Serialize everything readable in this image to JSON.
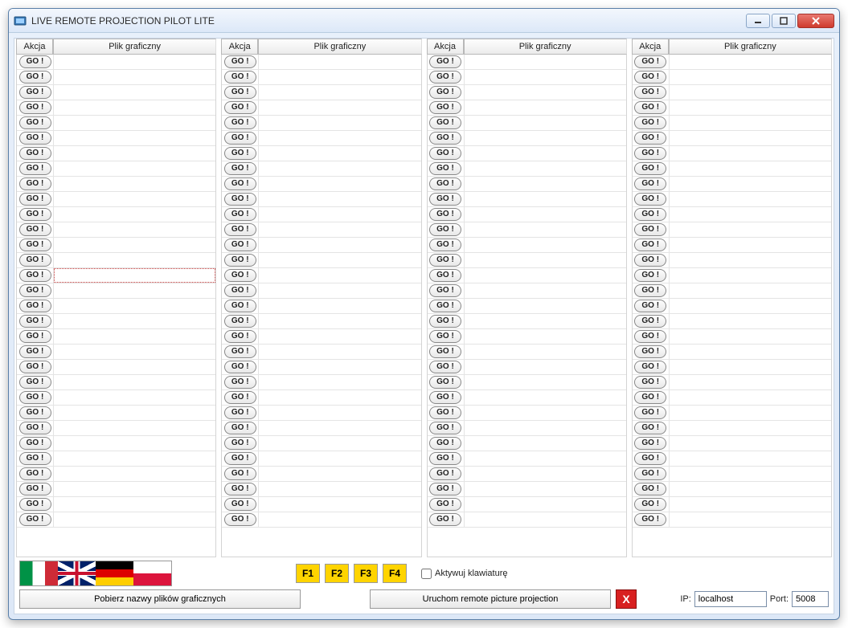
{
  "window": {
    "title": "LIVE REMOTE PROJECTION PILOT LITE"
  },
  "grid": {
    "header_action": "Akcja",
    "header_file": "Plik graficzny",
    "go_label": "GO !",
    "columns": 4,
    "rows_per_column": 31,
    "highlighted": {
      "col": 0,
      "row": 14
    }
  },
  "flags": [
    {
      "name": "italian",
      "css": "flag-it"
    },
    {
      "name": "english",
      "css": "flag-uk"
    },
    {
      "name": "german",
      "css": "flag-de"
    },
    {
      "name": "polish",
      "css": "flag-pl"
    }
  ],
  "fkeys": [
    "F1",
    "F2",
    "F3",
    "F4"
  ],
  "keyboard_checkbox_label": "Aktywuj klawiaturę",
  "buttons": {
    "fetch_names": "Pobierz nazwy plików graficznych",
    "run_projection": "Uruchom remote picture projection",
    "stop_label": "X"
  },
  "connection": {
    "ip_label": "IP:",
    "ip_value": "localhost",
    "port_label": "Port:",
    "port_value": "5008"
  }
}
